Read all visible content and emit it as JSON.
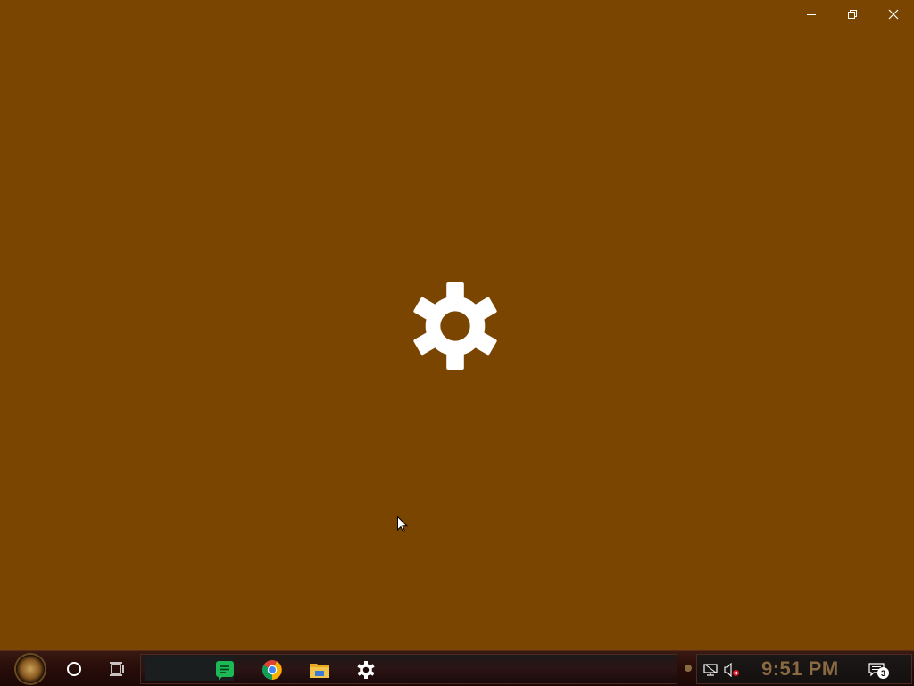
{
  "splash": {
    "background_color": "#7a4500",
    "center_icon": "settings-gear-icon",
    "window_controls": [
      "minimize-icon",
      "restore-icon",
      "close-icon"
    ]
  },
  "taskbar": {
    "start_icon": "steampunk-start-dial-icon",
    "cortana_icon": "cortana-circle-icon",
    "task_view_icon": "task-view-icon",
    "pinned_apps": [
      {
        "name": "notes-app",
        "icon": "green-note-icon",
        "color": "#1db954"
      },
      {
        "name": "chrome",
        "icon": "chrome-icon"
      },
      {
        "name": "file-explorer",
        "icon": "folder-icon",
        "color": "#f3b930"
      },
      {
        "name": "settings",
        "icon": "gear-icon",
        "color": "#ffffff"
      }
    ],
    "tray": {
      "network_icon": "network-icon",
      "volume_icon": "volume-muted-icon",
      "clock": "9:51 PM",
      "notification_count": "3"
    }
  }
}
